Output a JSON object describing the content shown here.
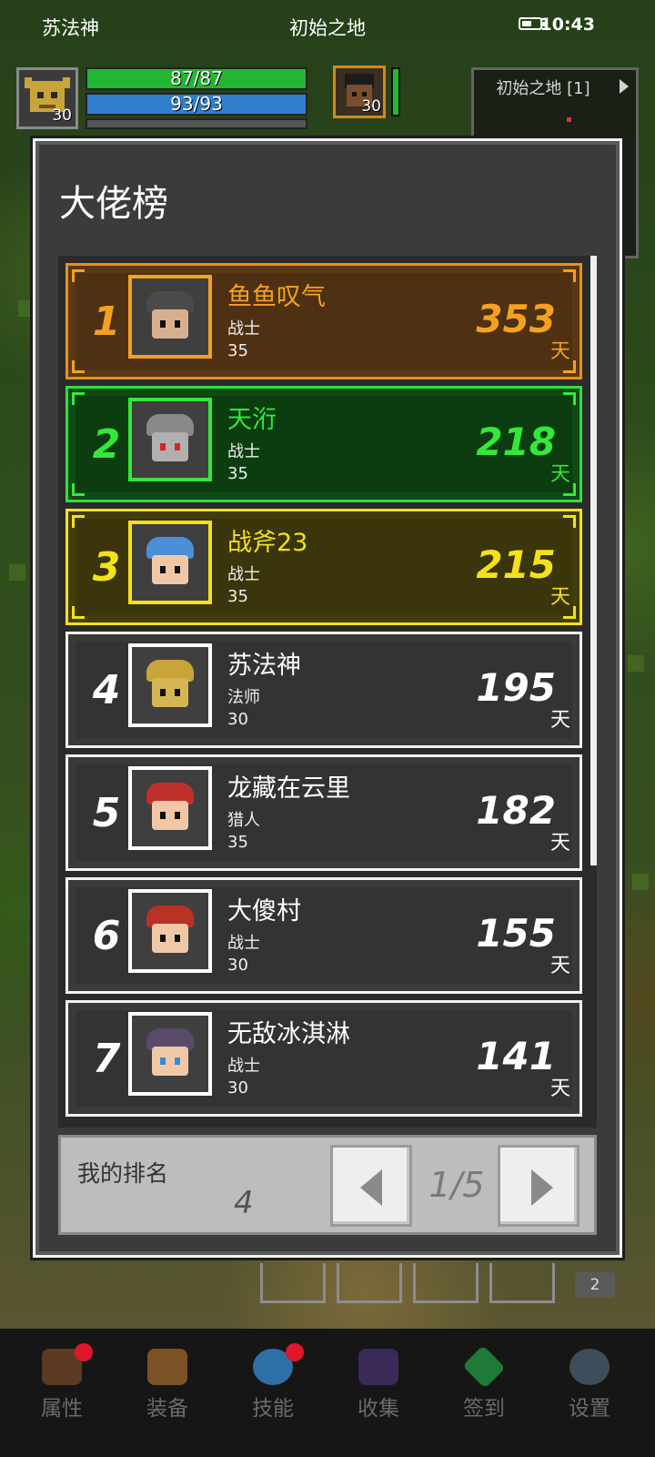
{
  "status_bar": {
    "player_name": "苏法神",
    "location": "初始之地",
    "time": "10:43"
  },
  "hud": {
    "player_level": "30",
    "hp": "87/87",
    "mp": "93/93",
    "pet_level": "30",
    "minimap_title": "初始之地 [1]"
  },
  "modal": {
    "title": "大佬榜",
    "entries": [
      {
        "rank": "1",
        "name": "鱼鱼叹气",
        "class": "战士",
        "level": "35",
        "value": "353",
        "unit": "天",
        "tier": "gold"
      },
      {
        "rank": "2",
        "name": "天洐",
        "class": "战士",
        "level": "35",
        "value": "218",
        "unit": "天",
        "tier": "green"
      },
      {
        "rank": "3",
        "name": "战斧23",
        "class": "战士",
        "level": "35",
        "value": "215",
        "unit": "天",
        "tier": "yellow"
      },
      {
        "rank": "4",
        "name": "苏法神",
        "class": "法师",
        "level": "30",
        "value": "195",
        "unit": "天",
        "tier": "plain"
      },
      {
        "rank": "5",
        "name": "龙藏在云里",
        "class": "猎人",
        "level": "35",
        "value": "182",
        "unit": "天",
        "tier": "plain"
      },
      {
        "rank": "6",
        "name": "大傻村",
        "class": "战士",
        "level": "30",
        "value": "155",
        "unit": "天",
        "tier": "plain"
      },
      {
        "rank": "7",
        "name": "无敌冰淇淋",
        "class": "战士",
        "level": "30",
        "value": "141",
        "unit": "天",
        "tier": "plain"
      }
    ],
    "my_rank_label": "我的排名",
    "my_rank_value": "4",
    "page_indicator": "1/5"
  },
  "chip_count": "2",
  "bottom_nav": [
    {
      "label": "属性",
      "icon": "helmet-icon",
      "badge": true
    },
    {
      "label": "装备",
      "icon": "bag-icon",
      "badge": false
    },
    {
      "label": "技能",
      "icon": "skill-gem-icon",
      "badge": true
    },
    {
      "label": "收集",
      "icon": "collection-icon",
      "badge": false
    },
    {
      "label": "签到",
      "icon": "checkin-gem-icon",
      "badge": false
    },
    {
      "label": "设置",
      "icon": "gear-icon",
      "badge": false
    }
  ],
  "colors": {
    "gold": "#f4a11f",
    "green": "#34e83a",
    "yellow": "#f4e11a",
    "hp": "#22b733",
    "mp": "#2f7fce",
    "badge": "#e0162b"
  }
}
